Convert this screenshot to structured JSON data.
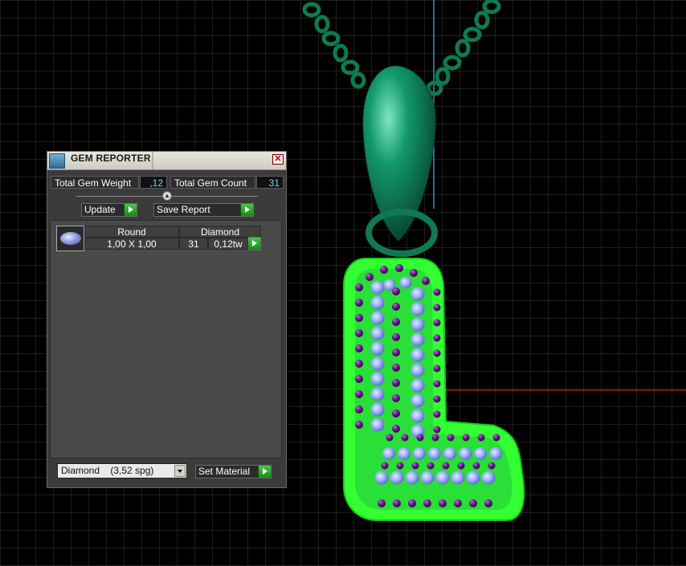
{
  "panel": {
    "title": "GEM REPORTER",
    "total_weight_label": "Total Gem Weight",
    "total_weight_value": ",12",
    "total_count_label": "Total Gem Count",
    "total_count_value": "31",
    "update_label": "Update",
    "save_report_label": "Save Report",
    "gem_row": {
      "shape": "Round",
      "material": "Diamond",
      "size": "1,00 X 1,00",
      "count": "31",
      "weight": "0,12tw"
    },
    "material_select": "Diamond    (3,52 spg)",
    "set_material_label": "Set Material"
  },
  "icons": {
    "logo": "gem-reporter-logo-icon",
    "close": "close-icon",
    "gem": "round-gem-icon"
  },
  "colors": {
    "pendant_green": "#0f7a52",
    "halo_green": "#33ff33",
    "gem_purple": "#5a1780",
    "gem_blue": "#8fa6ff"
  }
}
